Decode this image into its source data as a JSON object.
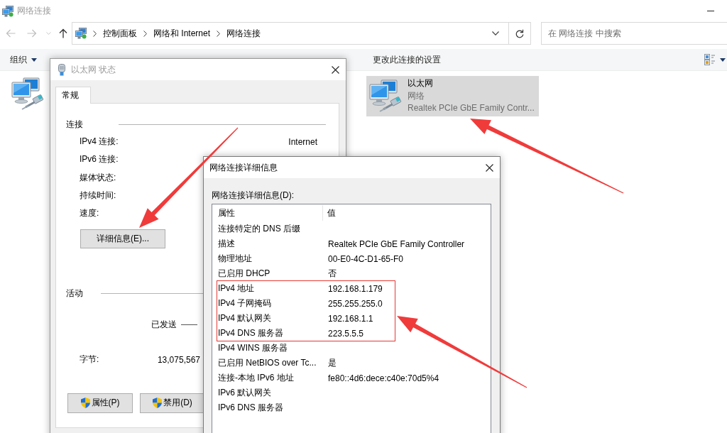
{
  "explorer": {
    "title": "网络连接",
    "active": false,
    "navigation": {
      "back": {
        "disabled": true
      },
      "forward": {
        "disabled": true
      },
      "up": {
        "disabled": false
      }
    },
    "breadcrumb": [
      "控制面板",
      "网络和 Internet",
      "网络连接"
    ],
    "search": {
      "placeholder": "在 网络连接 中搜索"
    },
    "toolbar": [
      {
        "label": "组织",
        "kind": "menu"
      },
      {
        "label": "更改此连接的设置",
        "kind": "command"
      }
    ],
    "items": [
      {
        "selected": false
      },
      {
        "name": "以太网",
        "status": "网络",
        "adapter": "Realtek PCIe GbE Family Contr...",
        "selected": true
      }
    ]
  },
  "status_dialog": {
    "title": "以太网 状态",
    "active": false,
    "tabs": [
      {
        "label": "常规",
        "selected": true
      }
    ],
    "connection": {
      "heading": "连接",
      "fields": [
        {
          "label": "IPv4 连接:",
          "value": "Internet"
        },
        {
          "label": "IPv6 连接:"
        },
        {
          "label": "媒体状态:"
        },
        {
          "label": "持续时间:"
        },
        {
          "label": "速度:"
        }
      ],
      "details_button": "详细信息(E)..."
    },
    "activity": {
      "heading": "活动",
      "sent_label": "已发送",
      "bytes_label": "字节:",
      "bytes_sent": "13,075,567"
    },
    "buttons": [
      {
        "label": "属性(P)",
        "shield": true
      },
      {
        "label": "禁用(D)",
        "shield": true
      }
    ]
  },
  "details_dialog": {
    "title": "网络连接详细信息",
    "active": true,
    "list_label": "网络连接详细信息(D):",
    "columns": [
      "属性",
      "值"
    ],
    "rows": [
      {
        "property": "连接特定的 DNS 后缀",
        "highlighted": false
      },
      {
        "property": "描述",
        "value": "Realtek PCIe GbE Family Controller",
        "highlighted": false
      },
      {
        "property": "物理地址",
        "value": "00-E0-4C-D1-65-F0",
        "highlighted": false
      },
      {
        "property": "已启用 DHCP",
        "value": "否",
        "highlighted": false
      },
      {
        "property": "IPv4 地址",
        "value": "192.168.1.179",
        "highlighted": true
      },
      {
        "property": "IPv4 子网掩码",
        "value": "255.255.255.0",
        "highlighted": true
      },
      {
        "property": "IPv4 默认网关",
        "value": "192.168.1.1",
        "highlighted": true
      },
      {
        "property": "IPv4 DNS 服务器",
        "value": "223.5.5.5",
        "highlighted": true
      },
      {
        "property": "IPv4 WINS 服务器",
        "highlighted": false
      },
      {
        "property": "已启用 NetBIOS over Tc...",
        "value": "是",
        "highlighted": false
      },
      {
        "property": "连接-本地 IPv6 地址",
        "value": "fe80::4d6:dece:c40e:70d5%4",
        "highlighted": false
      },
      {
        "property": "IPv6 默认网关",
        "highlighted": false
      },
      {
        "property": "IPv6 DNS 服务器",
        "highlighted": false
      }
    ]
  }
}
